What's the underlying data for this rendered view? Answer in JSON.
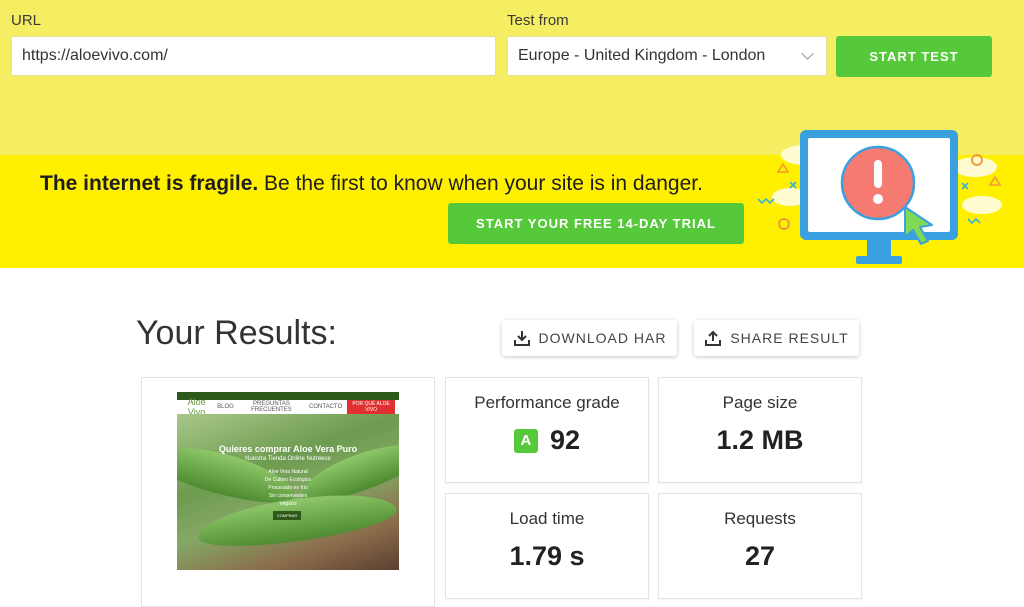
{
  "form": {
    "url_label": "URL",
    "url_value": "https://aloevivo.com/",
    "test_from_label": "Test from",
    "test_from_value": "Europe - United Kingdom - London",
    "start_button": "START TEST"
  },
  "banner": {
    "headline_bold": "The internet is fragile.",
    "headline_rest": " Be the first to know when your site is in danger.",
    "trial_button": "START YOUR FREE 14-DAY TRIAL"
  },
  "results": {
    "title": "Your Results:",
    "download_label": "DOWNLOAD HAR",
    "share_label": "SHARE RESULT",
    "performance": {
      "label": "Performance grade",
      "grade": "A",
      "value": "92"
    },
    "page_size": {
      "label": "Page size",
      "value": "1.2 MB"
    },
    "load_time": {
      "label": "Load time",
      "value": "1.79 s"
    },
    "requests": {
      "label": "Requests",
      "value": "27"
    }
  },
  "thumbnail": {
    "logo": "Aloe Vivo",
    "nav": [
      "BLOG",
      "PREGUNTAS FRECUENTES",
      "CONTACTO"
    ],
    "nav_cta": "POR QUÉ ALOE VIVO",
    "heading": "Quieres comprar Aloe Vera Puro",
    "subheading": "Nuestra Tienda Online Nutreece",
    "lines": [
      "Aloe Vera Natural",
      "De Cultivo Ecológico",
      "Procesado en frío",
      "Sin conservantes",
      "Vegano"
    ],
    "button": "COMPRAR"
  },
  "colors": {
    "top_bg": "#f6ee62",
    "banner_bg": "#fff000",
    "accent_green": "#56c93a"
  }
}
